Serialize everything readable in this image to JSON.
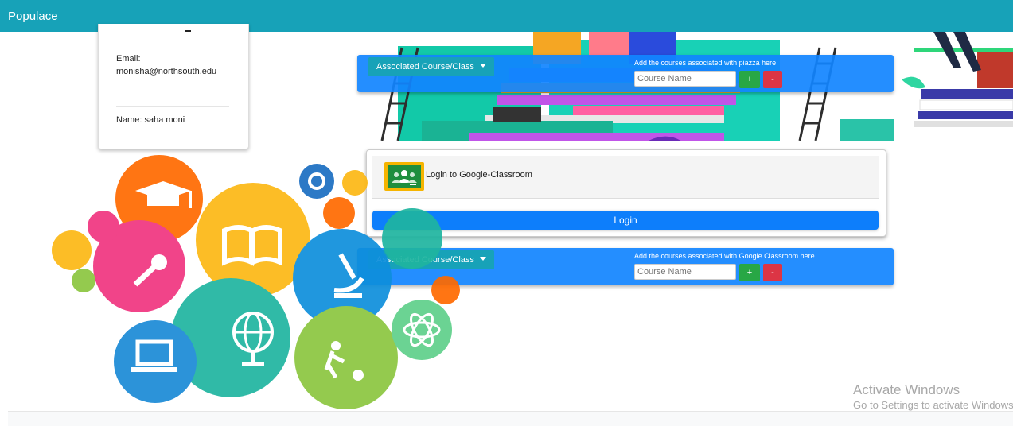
{
  "app": {
    "brand": "Populace"
  },
  "profile": {
    "email_label": "Email:",
    "email_value": "monisha@northsouth.edu",
    "name_label": "Name: saha moni"
  },
  "piazza_section": {
    "dropdown_label": "Associated Course/Class",
    "hint": "Add the courses associated with piazza here",
    "input_placeholder": "Course Name",
    "add_label": "+",
    "remove_label": "-"
  },
  "google_classroom": {
    "title": "Login to Google-Classroom",
    "login_label": "Login"
  },
  "classroom_section": {
    "dropdown_label": "Associated Course/Class",
    "hint": "Add the courses associated with Google Classroom here",
    "input_placeholder": "Course Name",
    "add_label": "+",
    "remove_label": "-"
  },
  "watermark": {
    "line1": "Activate Windows",
    "line2": "Go to Settings to activate Windows."
  },
  "colors": {
    "topbar": "#17a2b8",
    "primary": "#0d7efb",
    "success": "#28a745",
    "danger": "#dc3545"
  }
}
